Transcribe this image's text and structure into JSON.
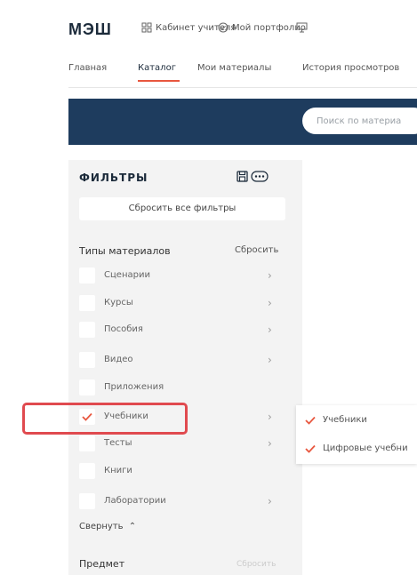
{
  "header": {
    "logo": "МЭШ",
    "nav": [
      {
        "label": "Кабинет учителя",
        "icon": "org-chart-icon"
      },
      {
        "label": "Мой портфолио",
        "icon": "check-circle-icon"
      },
      {
        "label": "",
        "icon": "monitor-icon"
      }
    ]
  },
  "subnav": {
    "items": [
      "Главная",
      "Каталог",
      "Мои материалы",
      "История просмотров"
    ],
    "active": "Каталог"
  },
  "search": {
    "placeholder": "Поиск по материа"
  },
  "filters": {
    "title": "ФИЛЬТРЫ",
    "reset_all": "Сбросить все фильтры",
    "types": {
      "heading": "Типы материалов",
      "reset": "Сбросить",
      "items": [
        {
          "label": "Сценарии",
          "checked": false,
          "has_submenu": true
        },
        {
          "label": "Курсы",
          "checked": false,
          "has_submenu": true
        },
        {
          "label": "Пособия",
          "checked": false,
          "has_submenu": true
        },
        {
          "label": "Видео",
          "checked": false,
          "has_submenu": true
        },
        {
          "label": "Приложения",
          "checked": false,
          "has_submenu": false
        },
        {
          "label": "Учебники",
          "checked": true,
          "has_submenu": true
        },
        {
          "label": "Тесты",
          "checked": false,
          "has_submenu": true
        },
        {
          "label": "Книги",
          "checked": false,
          "has_submenu": false
        },
        {
          "label": "Лаборатории",
          "checked": false,
          "has_submenu": true
        }
      ]
    },
    "collapse": "Свернуть",
    "subject": {
      "heading": "Предмет",
      "reset": "Сбросить"
    }
  },
  "submenu": {
    "items": [
      {
        "label": "Учебники",
        "checked": true
      },
      {
        "label": "Цифровые учебни",
        "checked": true
      }
    ]
  },
  "colors": {
    "accent": "#e8573f",
    "banner": "#1e3c5e",
    "highlight": "#e04a4f",
    "panel": "#f3f3f3"
  }
}
